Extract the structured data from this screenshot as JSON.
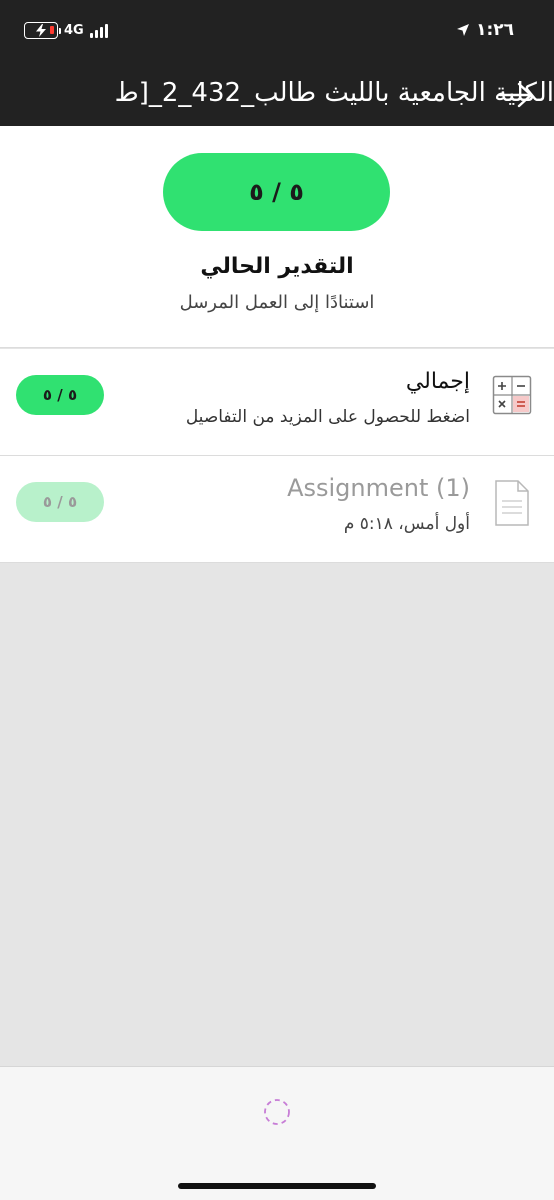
{
  "status_bar": {
    "time": "١:٢٦",
    "network": "4G"
  },
  "nav": {
    "title": "الكلية الجامعية بالليث طالب_432_2_[ط"
  },
  "summary": {
    "grade": "٥ / ٥",
    "title": "التقدير الحالي",
    "subtitle": "استنادًا إلى العمل المرسل"
  },
  "rows": [
    {
      "title": "إجمالي",
      "subtitle": "اضغط للحصول على المزيد من التفاصيل",
      "grade": "٥ / ٥",
      "icon": "calculator-icon"
    },
    {
      "title": "Assignment (1)",
      "subtitle": "أول أمس، ٥:١٨ م",
      "grade": "٥ / ٥",
      "icon": "document-icon"
    }
  ],
  "colors": {
    "header_bg": "#222222",
    "accent_green": "#30e171",
    "accent_green_faded": "#b8f1cb",
    "empty_bg": "#e5e5e5",
    "spinner": "#c77dd6"
  }
}
